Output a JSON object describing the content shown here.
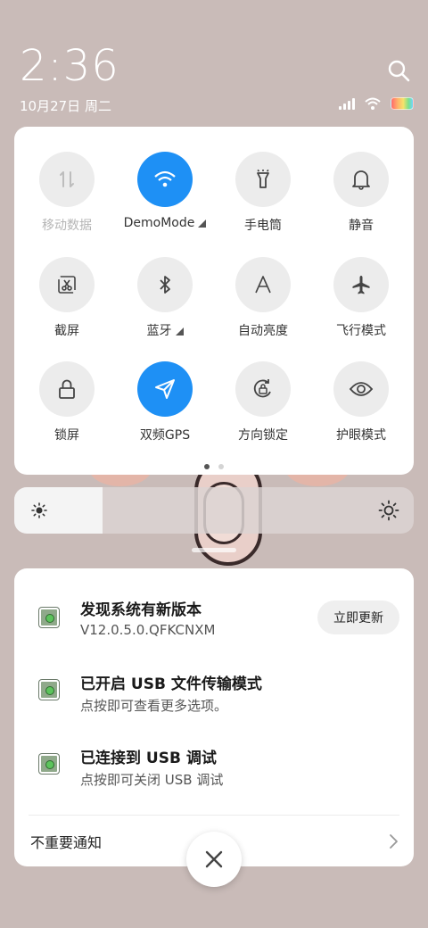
{
  "status": {
    "time": "2:36",
    "date": "10月27日 周二"
  },
  "control_center": {
    "tiles": [
      {
        "label": "移动数据",
        "icon": "mobile-data-icon",
        "state": "disabled"
      },
      {
        "label": "DemoMode",
        "icon": "wifi-icon",
        "state": "active"
      },
      {
        "label": "手电筒",
        "icon": "flashlight-icon",
        "state": "off"
      },
      {
        "label": "静音",
        "icon": "bell-icon",
        "state": "off"
      },
      {
        "label": "截屏",
        "icon": "screenshot-icon",
        "state": "off"
      },
      {
        "label": "蓝牙",
        "icon": "bluetooth-icon",
        "state": "off"
      },
      {
        "label": "自动亮度",
        "icon": "auto-brightness-icon",
        "state": "off"
      },
      {
        "label": "飞行模式",
        "icon": "airplane-icon",
        "state": "off"
      },
      {
        "label": "锁屏",
        "icon": "lock-icon",
        "state": "off"
      },
      {
        "label": "双频GPS",
        "icon": "gps-icon",
        "state": "active"
      },
      {
        "label": "方向锁定",
        "icon": "rotation-lock-icon",
        "state": "off"
      },
      {
        "label": "护眼模式",
        "icon": "eye-icon",
        "state": "off"
      }
    ],
    "page_count": 2,
    "current_page": 1
  },
  "brightness": {
    "level": 0.22
  },
  "notifications": [
    {
      "title": "发现系统有新版本",
      "body": "V12.0.5.0.QFKCNXM",
      "action": "立即更新"
    },
    {
      "title": "已开启 USB 文件传输模式",
      "body": "点按即可查看更多选项。"
    },
    {
      "title": "已连接到 USB 调试",
      "body": "点按即可关闭 USB 调试"
    }
  ],
  "unimportant_label": "不重要通知",
  "colors": {
    "accent": "#1e90f5",
    "background": "#c9bbb8"
  }
}
